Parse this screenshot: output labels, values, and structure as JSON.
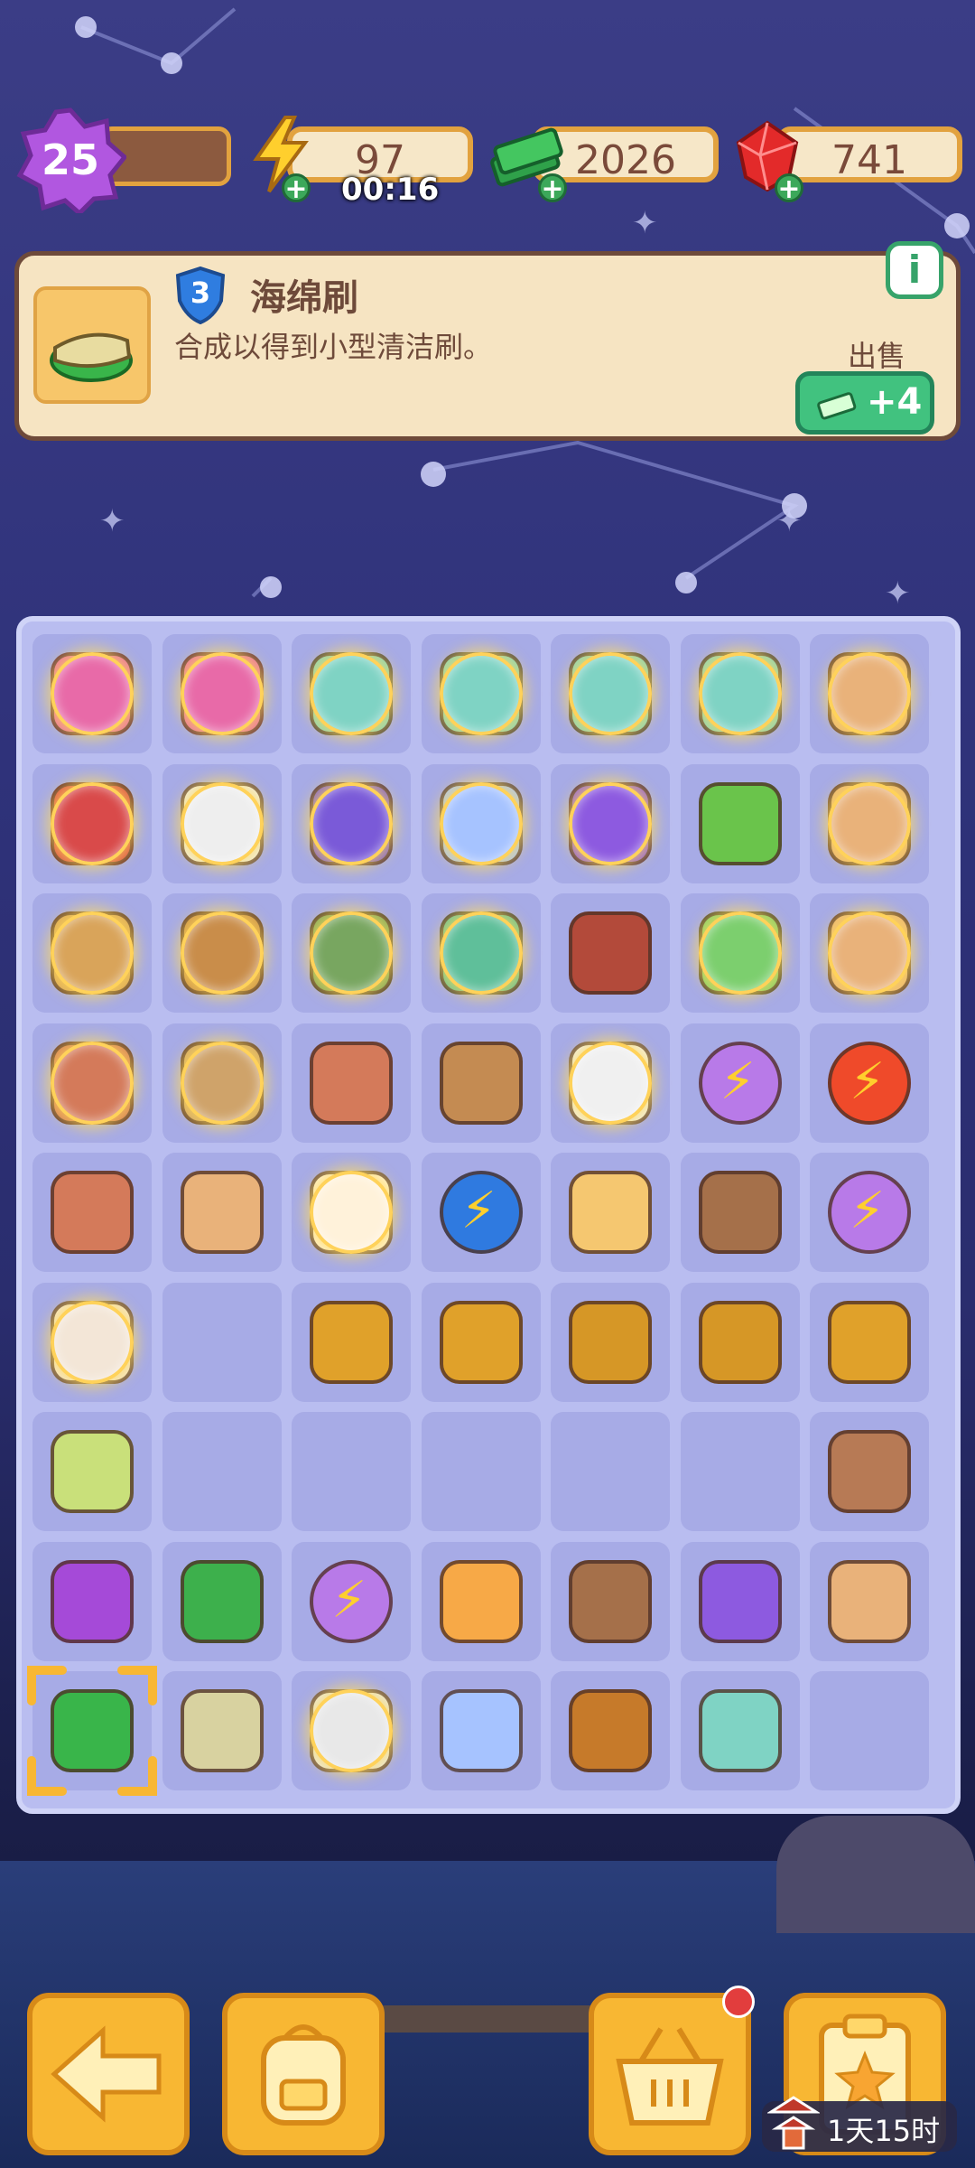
{
  "hud": {
    "level": "25",
    "energy_value": "97",
    "energy_timer": "00:16",
    "cash_value": "2026",
    "gems_value": "741"
  },
  "info": {
    "rank": "3",
    "item_name": "海绵刷",
    "item_desc": "合成以得到小型清洁刷。",
    "info_icon": "i",
    "sell_label": "出售",
    "sell_value": "+4"
  },
  "board": {
    "rows": [
      [
        "glowing-flower-basket",
        "glowing-flower-basket",
        "glowing-first-aid-bottle",
        "glowing-first-aid-bottle",
        "glowing-first-aid-bottle",
        "glowing-first-aid-bottle",
        "glowing-golden-vase"
      ],
      [
        "glowing-red-machine",
        "glowing-sink",
        "glowing-spider-cart",
        "glowing-gear-plate",
        "glowing-purple-mirror",
        "green-potted-plant",
        "glowing-colorful-vase"
      ],
      [
        "glowing-box-house",
        "glowing-wooden-crates",
        "glowing-green-cabinet",
        "glowing-green-stack",
        "retro-tv",
        "glowing-tree-globe",
        "glowing-round-vase"
      ],
      [
        "glowing-ripped-box",
        "glowing-fish-frame",
        "red-toolbox",
        "cherub-painting",
        "glowing-torn-paper",
        "energy-orb-purple",
        "energy-orb-red"
      ],
      [
        "red-box",
        "pink-vase",
        "glowing-lucky-cat",
        "energy-orb-blue",
        "golden-cubes",
        "brown-bucket",
        "energy-orb-purple-2"
      ],
      [
        "glowing-white-jar",
        "empty",
        "trophy-figure",
        "winged-trophy",
        "golden-cup",
        "dragon-statue",
        "star-trophy"
      ],
      [
        "green-sponge-stone",
        "empty",
        "empty",
        "empty",
        "empty",
        "empty",
        "cracked-pot"
      ],
      [
        "purple-slime",
        "green-mop-head",
        "energy-orb-purple-3",
        "hourglass-tile",
        "yellow-bucket",
        "hand-mirror",
        "striped-vase"
      ],
      [
        "selected-sponge-brush",
        "broom",
        "glowing-broken-toilet",
        "yellow-clay-plate",
        "telescope",
        "perfume-bottle",
        "empty"
      ]
    ]
  },
  "bottom": {
    "timer": "1天15时"
  }
}
